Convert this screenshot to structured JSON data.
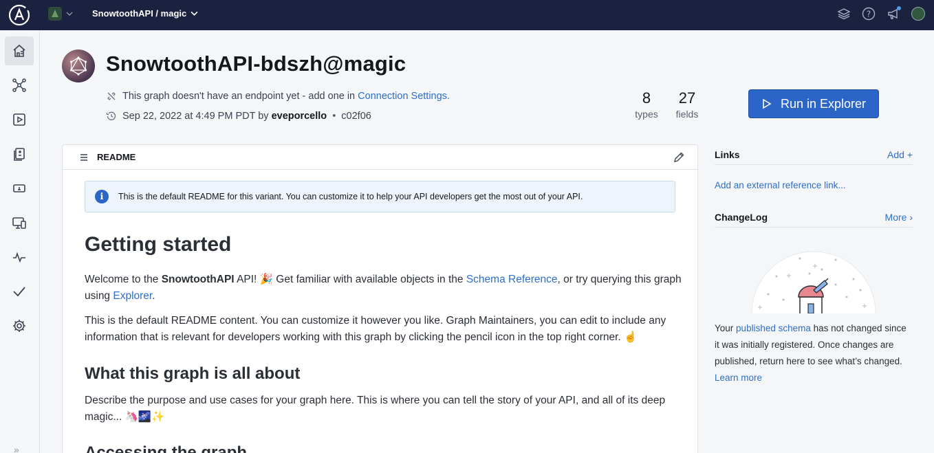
{
  "topbar": {
    "breadcrumb": "SnowtoothAPI / magic",
    "icons": [
      "apollo-logo-icon",
      "org-avatar-icon",
      "chevron-down-icon",
      "layers-icon",
      "help-icon",
      "announcement-icon",
      "user-avatar-icon"
    ]
  },
  "sidebar": {
    "items": [
      "home-icon",
      "schema-graph-icon",
      "explorer-play-icon",
      "changelog-doc-icon",
      "operations-icon",
      "clients-icon",
      "insights-pulse-icon",
      "checks-icon",
      "settings-gear-icon"
    ],
    "collapse": "»"
  },
  "header": {
    "title": "SnowtoothAPI-bdszh@magic",
    "endpoint_text": "This graph doesn't have an endpoint yet - add one in",
    "endpoint_link": "Connection Settings.",
    "date": "Sep 22, 2022 at 4:49 PM PDT by",
    "author": "eveporcello",
    "commit": "c02f06",
    "types_count": "8",
    "types_label": "types",
    "fields_count": "27",
    "fields_label": "fields",
    "run_button": "Run in Explorer"
  },
  "readme": {
    "title": "README",
    "info": "This is the default README for this variant. You can customize it to help your API developers get the most out of your API.",
    "h_getting_started": "Getting started",
    "p1_a": "Welcome to the",
    "p1_b": "SnowtoothAPI",
    "p1_c": "API! 🎉 Get familiar with available objects in the",
    "p1_link1": "Schema Reference",
    "p1_d": ", or try querying this graph using",
    "p1_link2": "Explorer",
    "p1_e": ".",
    "p2": "This is the default README content. You can customize it however you like. Graph Maintainers, you can edit to include any information that is relevant for developers working with this graph by clicking the pencil icon in the top right corner. ☝️",
    "h_about": "What this graph is all about",
    "p3": "Describe the purpose and use cases for your graph here. This is where you can tell the story of your API, and all of its deep magic... 🦄🌌✨",
    "h_accessing": "Accessing the graph"
  },
  "links": {
    "title": "Links",
    "add": "Add +",
    "external": "Add an external reference link..."
  },
  "changelog": {
    "title": "ChangeLog",
    "more": "More ›",
    "text_a": "Your",
    "text_link": "published schema",
    "text_b": "has not changed since it was initially registered. Once changes are published, return here to see what’s changed.",
    "learn_more": "Learn more"
  }
}
